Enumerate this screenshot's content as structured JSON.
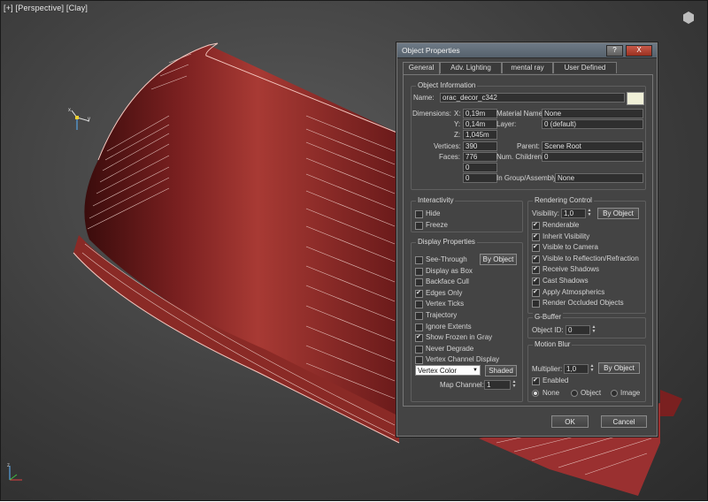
{
  "viewport": {
    "labels": [
      "[+]",
      "[Perspective]",
      "[Clay]"
    ],
    "gizmo_axes": [
      "x",
      "y",
      "z"
    ]
  },
  "dialog": {
    "title": "Object Properties",
    "titlebar_buttons": [
      "?",
      "X"
    ],
    "tabs": [
      "General",
      "Adv. Lighting",
      "mental ray",
      "User Defined"
    ],
    "object_info": {
      "title": "Object Information",
      "name_label": "Name:",
      "name_value": "orac_decor_c342",
      "color_swatch": "#f0f0d8",
      "dimensions_label": "Dimensions:",
      "x_label": "X:",
      "x_value": "0,19m",
      "y_label": "Y:",
      "y_value": "0,14m",
      "z_label": "Z:",
      "z_value": "1,045m",
      "vertices_label": "Vertices:",
      "vertices_value": "390",
      "faces_label": "Faces:",
      "faces_value": "776",
      "material_label": "Material Name:",
      "material_value": "None",
      "layer_label": "Layer:",
      "layer_value": "0 (default)",
      "parent_label": "Parent:",
      "parent_value": "Scene Root",
      "children_label": "Num. Children:",
      "children_value": "0",
      "extra1_value": "0",
      "extra2_value": "0",
      "group_label": "In Group/Assembly:",
      "group_value": "None"
    },
    "interactivity": {
      "title": "Interactivity",
      "hide": {
        "label": "Hide",
        "checked": false
      },
      "freeze": {
        "label": "Freeze",
        "checked": false
      }
    },
    "display": {
      "title": "Display Properties",
      "by_object": "By Object",
      "items": [
        {
          "label": "See-Through",
          "checked": false
        },
        {
          "label": "Display as Box",
          "checked": false
        },
        {
          "label": "Backface Cull",
          "checked": false
        },
        {
          "label": "Edges Only",
          "checked": true
        },
        {
          "label": "Vertex Ticks",
          "checked": false
        },
        {
          "label": "Trajectory",
          "checked": false
        },
        {
          "label": "Ignore Extents",
          "checked": false
        },
        {
          "label": "Show Frozen in Gray",
          "checked": true
        },
        {
          "label": "Never Degrade",
          "checked": false
        },
        {
          "label": "Vertex Channel Display",
          "checked": false
        }
      ],
      "vertex_color": "Vertex Color",
      "shaded": "Shaded",
      "map_channel_label": "Map Channel:",
      "map_channel_value": "1"
    },
    "rendering": {
      "title": "Rendering Control",
      "visibility_label": "Visibility:",
      "visibility_value": "1,0",
      "by_object": "By Object",
      "items": [
        {
          "label": "Renderable",
          "checked": true
        },
        {
          "label": "Inherit Visibility",
          "checked": true
        },
        {
          "label": "Visible to Camera",
          "checked": true
        },
        {
          "label": "Visible to Reflection/Refraction",
          "checked": true
        },
        {
          "label": "Receive Shadows",
          "checked": true
        },
        {
          "label": "Cast Shadows",
          "checked": true
        },
        {
          "label": "Apply Atmospherics",
          "checked": true
        },
        {
          "label": "Render Occluded Objects",
          "checked": false
        }
      ]
    },
    "gbuffer": {
      "title": "G-Buffer",
      "object_id_label": "Object ID:",
      "object_id_value": "0"
    },
    "motion_blur": {
      "title": "Motion Blur",
      "multiplier_label": "Multiplier:",
      "multiplier_value": "1,0",
      "by_object": "By Object",
      "enabled_label": "Enabled",
      "enabled_checked": true,
      "options": [
        {
          "label": "None",
          "selected": true
        },
        {
          "label": "Object",
          "selected": false
        },
        {
          "label": "Image",
          "selected": false
        }
      ]
    },
    "ok": "OK",
    "cancel": "Cancel"
  }
}
